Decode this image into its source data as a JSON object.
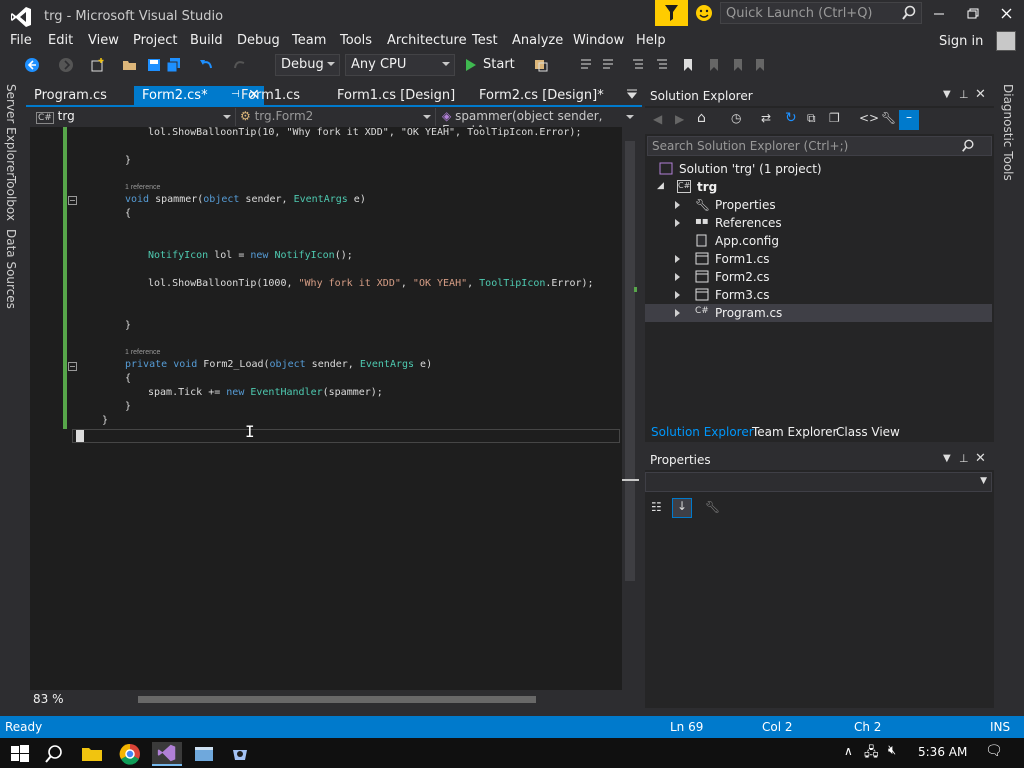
{
  "window": {
    "title": "trg - Microsoft Visual Studio",
    "quick_launch_placeholder": "Quick Launch (Ctrl+Q)"
  },
  "menu": [
    "File",
    "Edit",
    "View",
    "Project",
    "Build",
    "Debug",
    "Team",
    "Tools",
    "Architecture",
    "Test",
    "Analyze",
    "Window",
    "Help"
  ],
  "account": {
    "signin_label": "Sign in"
  },
  "toolbar": {
    "configuration": "Debug",
    "platform": "Any CPU",
    "start_label": "Start"
  },
  "side_tabs_left": [
    "Server Explorer",
    "Toolbox",
    "Data Sources"
  ],
  "side_tabs_right": [
    "Diagnostic Tools"
  ],
  "doc_tabs": [
    {
      "label": "Program.cs",
      "active": false
    },
    {
      "label": "Form2.cs*",
      "active": true
    },
    {
      "label": "Form1.cs",
      "active": false
    },
    {
      "label": "Form1.cs [Design]",
      "active": false
    },
    {
      "label": "Form2.cs [Design]*",
      "active": false
    }
  ],
  "nav": {
    "project": "trg",
    "class": "trg.Form2",
    "member": "spammer(object sender, EventA"
  },
  "code": {
    "line1": "lol.ShowBalloonTip(10, \"Why fork it XDD\", \"OK YEAH\", ToolTipIcon.Error);",
    "ref1": "1 reference",
    "ref2": "1 reference"
  },
  "editor": {
    "zoom": "83 %"
  },
  "solution_explorer": {
    "title": "Solution Explorer",
    "search_placeholder": "Search Solution Explorer (Ctrl+;)",
    "solution": "Solution 'trg' (1 project)",
    "project": "trg",
    "items": [
      {
        "label": "Properties",
        "expandable": true,
        "icon": "wrench-icon"
      },
      {
        "label": "References",
        "expandable": true,
        "icon": "references-icon"
      },
      {
        "label": "App.config",
        "expandable": false,
        "icon": "config-file-icon"
      },
      {
        "label": "Form1.cs",
        "expandable": true,
        "icon": "form-icon"
      },
      {
        "label": "Form2.cs",
        "expandable": true,
        "icon": "form-icon"
      },
      {
        "label": "Form3.cs",
        "expandable": true,
        "icon": "form-icon"
      },
      {
        "label": "Program.cs",
        "expandable": true,
        "icon": "csharp-file-icon",
        "selected": true
      }
    ],
    "tabs": [
      "Solution Explorer",
      "Team Explorer",
      "Class View"
    ]
  },
  "properties": {
    "title": "Properties"
  },
  "status": {
    "state": "Ready",
    "line": "Ln 69",
    "col": "Col 2",
    "ch": "Ch 2",
    "mode": "INS"
  },
  "taskbar": {
    "time": "5:36 AM"
  },
  "colors": {
    "accent": "#007acc",
    "background": "#2d2d30",
    "editor_bg": "#1e1e1e",
    "keyword": "#569cd6",
    "type": "#4ec9b0",
    "string": "#d69d85",
    "change_bar": "#57a64a",
    "notification": "#ffcc00"
  }
}
